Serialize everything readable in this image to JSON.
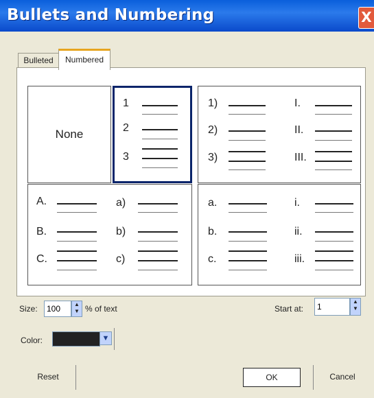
{
  "window": {
    "title": "Bullets and Numbering",
    "close_glyph": "X"
  },
  "tabs": [
    {
      "label": "Bulleted",
      "active": false
    },
    {
      "label": "Numbered",
      "active": true
    }
  ],
  "styles": {
    "none_label": "None",
    "arabic_dot": [
      "1",
      "2",
      "3"
    ],
    "arabic_paren": [
      "1)",
      "2)",
      "3)"
    ],
    "roman_upper": [
      "I.",
      "II.",
      "III."
    ],
    "alpha_upper": [
      "A.",
      "B.",
      "C."
    ],
    "alpha_lower_paren": [
      "a)",
      "b)",
      "c)"
    ],
    "alpha_lower_dot": [
      "a.",
      "b.",
      "c."
    ],
    "roman_lower": [
      "i.",
      "ii.",
      "iii."
    ]
  },
  "size": {
    "label": "Size:",
    "value": "100",
    "suffix": "% of text"
  },
  "start_at": {
    "label": "Start at:",
    "value": "1"
  },
  "color": {
    "label": "Color:",
    "swatch_color": "#222222"
  },
  "buttons": {
    "reset": "Reset",
    "ok": "OK",
    "cancel": "Cancel"
  },
  "colors": {
    "titlebar": "#0A5FDB",
    "dialog_bg": "#ECE9D8",
    "selection": "#0A246A",
    "tab_accent": "#E7A520"
  }
}
